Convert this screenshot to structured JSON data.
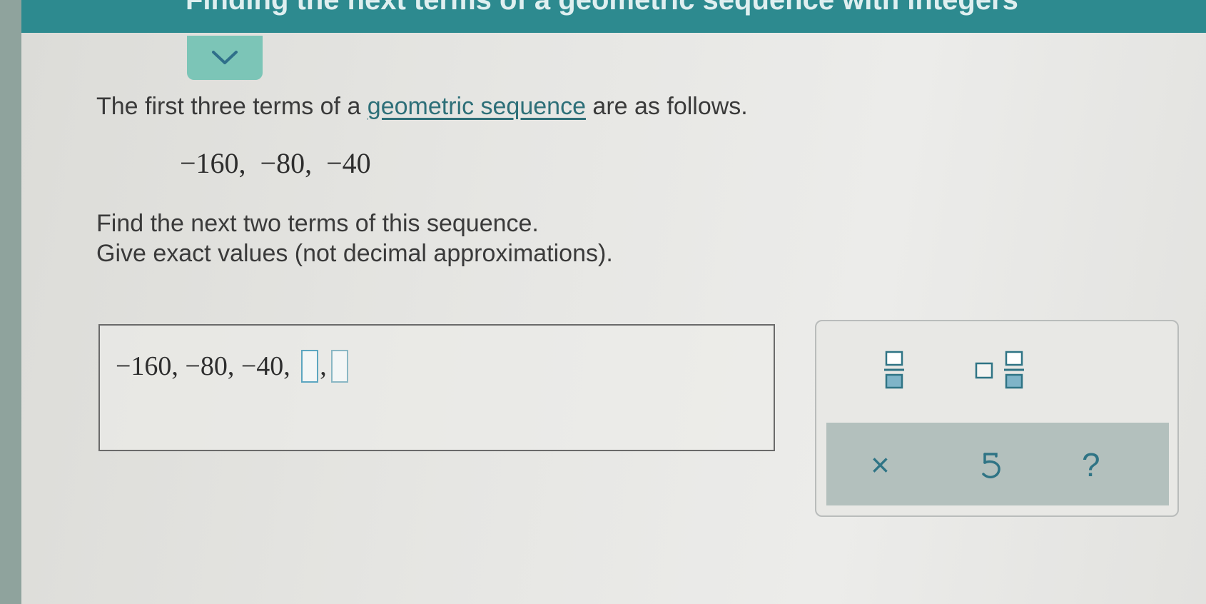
{
  "header": {
    "title": "Finding the next terms of a geometric sequence with integers"
  },
  "question": {
    "prompt_before": "The first three terms of a ",
    "prompt_link": "geometric sequence",
    "prompt_after": " are as follows.",
    "given_terms": "−160,  −80,  −40",
    "instruction_line1": "Find the next two terms of this sequence.",
    "instruction_line2": "Give exact values (not decimal approximations)."
  },
  "answer": {
    "prefix": "−160, −80, −40, ",
    "blank1_value": "",
    "separator": ",",
    "blank2_value": ""
  },
  "keypad": {
    "keys": [
      "fraction-template",
      "mixed-number-template"
    ],
    "actions": {
      "clear_symbol": "×",
      "help_symbol": "?"
    }
  },
  "colors": {
    "topbar": "#2d8a8f",
    "collapse_tab": "#7cc5b7",
    "link": "#2d6f78",
    "keypad_icon": "#2f7485",
    "action_bar": "#b3c0bd"
  }
}
